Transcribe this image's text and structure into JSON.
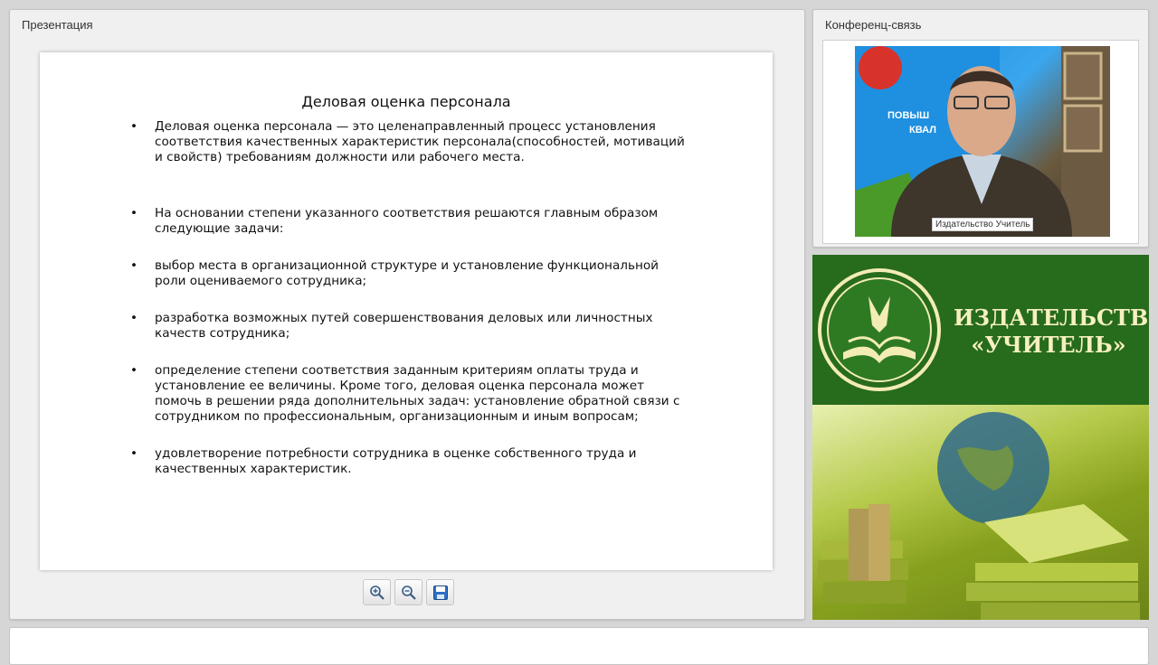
{
  "presentation_panel": {
    "title": "Презентация",
    "slide": {
      "title": "Деловая оценка персонала",
      "bullets": [
        {
          "marker": "•",
          "text": "Деловая оценка персонала — это целенаправленный процесс установления соответствия качественных характеристик персонала(способностей, мотиваций и свойств) требованиям должности или рабочего места."
        },
        {
          "marker": "•",
          "text": "На основании степени указанного соответствия решаются главным образом следующие задачи:"
        },
        {
          "marker": "•",
          "text": "выбор места в организационной структуре и установление функциональной роли оцениваемого сотрудника;"
        },
        {
          "marker": "•",
          "text": "разработка возможных путей совершенствования деловых или личностных качеств сотрудника;"
        },
        {
          "marker": "•",
          "text": "определение степени соответствия заданным критериям оплаты труда и установление ее величины.  Кроме того, деловая оценка персонала может помочь в решении ряда дополнительных задач: установление обратной связи с сотрудником по профессиональным, организационным и иным вопросам;"
        },
        {
          "marker": "•",
          "text": "удовлетворение потребности сотрудника в оценке собственного труда и качественных характеристик."
        }
      ]
    },
    "toolbar": {
      "zoom_in_icon": "zoom-in-icon",
      "zoom_out_icon": "zoom-out-icon",
      "save_icon": "save-icon"
    }
  },
  "conference_panel": {
    "title": "Конференц-связь",
    "video_caption": "Издательство Учитель",
    "background_sign_fragment": "ПОВЫШ",
    "background_sign_fragment2": "КВАЛ"
  },
  "publisher_banner": {
    "line1": "ИЗДАТЕЛЬСТВО",
    "line2": "«УЧИТЕЛЬ»",
    "brand_color": "#276b1c",
    "text_color": "#f6f0c0"
  }
}
